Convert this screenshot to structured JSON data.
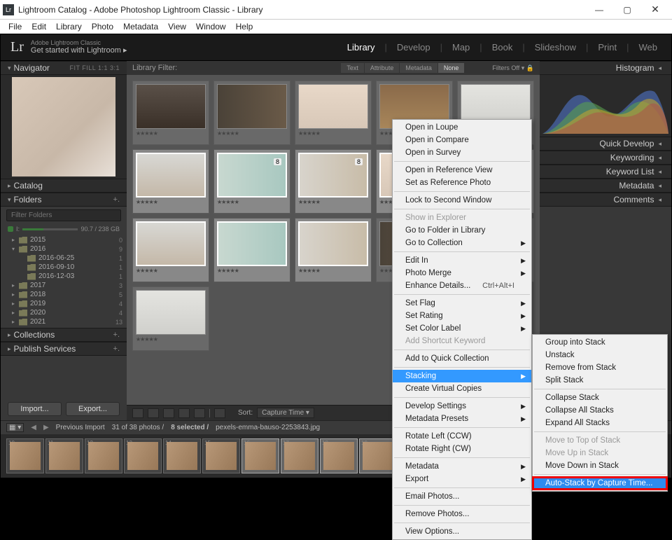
{
  "window": {
    "title": "Lightroom Catalog - Adobe Photoshop Lightroom Classic - Library"
  },
  "menubar": [
    "File",
    "Edit",
    "Library",
    "Photo",
    "Metadata",
    "View",
    "Window",
    "Help"
  ],
  "topbar": {
    "logo": "Lr",
    "sub1": "Adobe Lightroom Classic",
    "sub2": "Get started with Lightroom ▸"
  },
  "modules": [
    "Library",
    "Develop",
    "Map",
    "Book",
    "Slideshow",
    "Print",
    "Web"
  ],
  "modules_active": "Library",
  "left": {
    "navigator": {
      "title": "Navigator",
      "opts": "FIT  FILL  1:1   3:1"
    },
    "catalog": {
      "title": "Catalog"
    },
    "folders": {
      "title": "Folders",
      "filter_placeholder": "Filter Folders",
      "disk_label": "I:",
      "disk_text": "90.7 / 238 GB",
      "tree": [
        {
          "lvl": 1,
          "exp": "▸",
          "name": "2015",
          "cnt": "0"
        },
        {
          "lvl": 1,
          "exp": "▾",
          "name": "2016",
          "cnt": "9"
        },
        {
          "lvl": 2,
          "exp": "",
          "name": "2016-06-25",
          "cnt": "1"
        },
        {
          "lvl": 2,
          "exp": "",
          "name": "2016-09-10",
          "cnt": "1"
        },
        {
          "lvl": 2,
          "exp": "",
          "name": "2016-12-03",
          "cnt": "1"
        },
        {
          "lvl": 1,
          "exp": "▸",
          "name": "2017",
          "cnt": "3"
        },
        {
          "lvl": 1,
          "exp": "▸",
          "name": "2018",
          "cnt": "5"
        },
        {
          "lvl": 1,
          "exp": "▸",
          "name": "2019",
          "cnt": "4"
        },
        {
          "lvl": 1,
          "exp": "▸",
          "name": "2020",
          "cnt": "4"
        },
        {
          "lvl": 1,
          "exp": "▸",
          "name": "2021",
          "cnt": "13"
        }
      ]
    },
    "collections": {
      "title": "Collections"
    },
    "publish": {
      "title": "Publish Services"
    },
    "import_btn": "Import...",
    "export_btn": "Export..."
  },
  "right": {
    "histogram": "Histogram",
    "panels": [
      "Quick Develop",
      "Keywording",
      "Keyword List",
      "Metadata",
      "Comments"
    ]
  },
  "libfilter": {
    "label": "Library Filter:",
    "tabs": [
      "Text",
      "Attribute",
      "Metadata",
      "None"
    ],
    "filters_off": "Filters Off"
  },
  "grid_start": 16,
  "toolbar": {
    "sort_label": "Sort:",
    "sort_value": "Capture Time"
  },
  "status": {
    "prev": "Previous Import",
    "count": "31 of 38 photos /",
    "sel": "8 selected /",
    "file": "pexels-emma-bauso-2253843.jpg"
  },
  "ctx1": [
    {
      "t": "Open in Loupe"
    },
    {
      "t": "Open in Compare"
    },
    {
      "t": "Open in Survey"
    },
    {
      "sep": true
    },
    {
      "t": "Open in Reference View"
    },
    {
      "t": "Set as Reference Photo"
    },
    {
      "sep": true
    },
    {
      "t": "Lock to Second Window"
    },
    {
      "sep": true
    },
    {
      "t": "Show in Explorer",
      "dis": true
    },
    {
      "t": "Go to Folder in Library"
    },
    {
      "t": "Go to Collection",
      "sub": true
    },
    {
      "sep": true
    },
    {
      "t": "Edit In",
      "sub": true
    },
    {
      "t": "Photo Merge",
      "sub": true
    },
    {
      "t": "Enhance Details...",
      "sc": "Ctrl+Alt+I"
    },
    {
      "sep": true
    },
    {
      "t": "Set Flag",
      "sub": true
    },
    {
      "t": "Set Rating",
      "sub": true
    },
    {
      "t": "Set Color Label",
      "sub": true
    },
    {
      "t": "Add Shortcut Keyword",
      "dis": true
    },
    {
      "sep": true
    },
    {
      "t": "Add to Quick Collection"
    },
    {
      "sep": true
    },
    {
      "t": "Stacking",
      "sub": true,
      "hl": true
    },
    {
      "t": "Create Virtual Copies"
    },
    {
      "sep": true
    },
    {
      "t": "Develop Settings",
      "sub": true
    },
    {
      "t": "Metadata Presets",
      "sub": true
    },
    {
      "sep": true
    },
    {
      "t": "Rotate Left (CCW)"
    },
    {
      "t": "Rotate Right (CW)"
    },
    {
      "sep": true
    },
    {
      "t": "Metadata",
      "sub": true
    },
    {
      "t": "Export",
      "sub": true
    },
    {
      "sep": true
    },
    {
      "t": "Email Photos..."
    },
    {
      "sep": true
    },
    {
      "t": "Remove Photos..."
    },
    {
      "sep": true
    },
    {
      "t": "View Options..."
    }
  ],
  "ctx2": [
    {
      "t": "Group into Stack"
    },
    {
      "t": "Unstack"
    },
    {
      "t": "Remove from Stack"
    },
    {
      "t": "Split Stack"
    },
    {
      "sep": true
    },
    {
      "t": "Collapse Stack"
    },
    {
      "t": "Collapse All Stacks"
    },
    {
      "t": "Expand All Stacks"
    },
    {
      "sep": true
    },
    {
      "t": "Move to Top of Stack",
      "dis": true
    },
    {
      "t": "Move Up in Stack",
      "dis": true
    },
    {
      "t": "Move Down in Stack"
    },
    {
      "sep": true
    },
    {
      "t": "Auto-Stack by Capture Time...",
      "hl2": true
    }
  ]
}
